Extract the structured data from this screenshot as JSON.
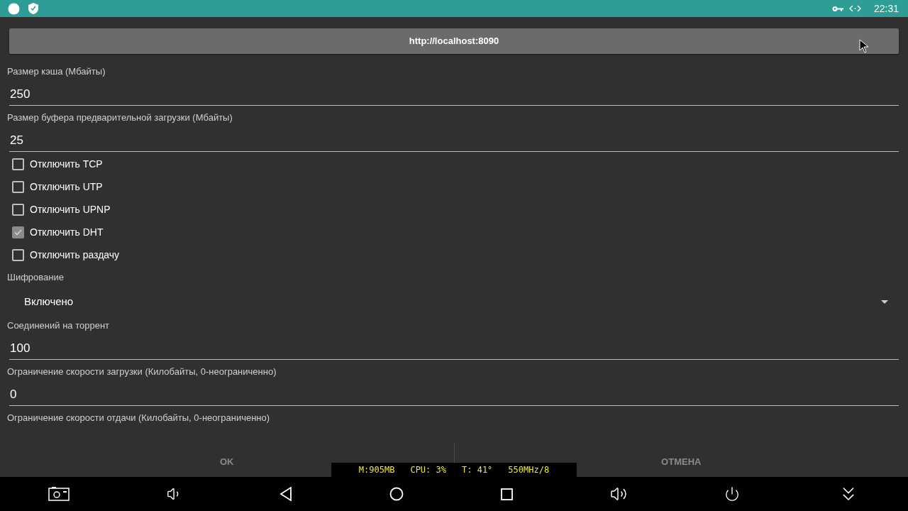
{
  "status_bar": {
    "time": "22:31"
  },
  "url_button": "http://localhost:8090",
  "settings": [
    {
      "kind": "label",
      "text": "Размер кэша (Мбайты)"
    },
    {
      "kind": "input",
      "value": "250"
    },
    {
      "kind": "label",
      "text": "Размер буфера предварительной загрузки (Мбайты)"
    },
    {
      "kind": "input",
      "value": "25"
    },
    {
      "kind": "checkbox",
      "text": "Отключить TCP",
      "checked": false
    },
    {
      "kind": "checkbox",
      "text": "Отключить UTP",
      "checked": false
    },
    {
      "kind": "checkbox",
      "text": "Отключить UPNP",
      "checked": false
    },
    {
      "kind": "checkbox",
      "text": "Отключить DHT",
      "checked": true
    },
    {
      "kind": "checkbox",
      "text": "Отключить раздачу",
      "checked": false
    },
    {
      "kind": "label",
      "text": "Шифрование"
    },
    {
      "kind": "dropdown",
      "value": "Включено"
    },
    {
      "kind": "label",
      "text": "Соединений на торрент"
    },
    {
      "kind": "input",
      "value": "100"
    },
    {
      "kind": "label",
      "text": "Ограничение скорости загрузки (Килобайты, 0-неограниченно)"
    },
    {
      "kind": "input",
      "value": "0"
    },
    {
      "kind": "label",
      "text": "Ограничение скорости отдачи (Килобайты, 0-неограниченно)"
    }
  ],
  "dialog_buttons": [
    "OK",
    "ОТМЕНА"
  ],
  "system_stats": [
    "M:905MB",
    "CPU: 3%",
    "T: 41°",
    "550MHz/8"
  ]
}
